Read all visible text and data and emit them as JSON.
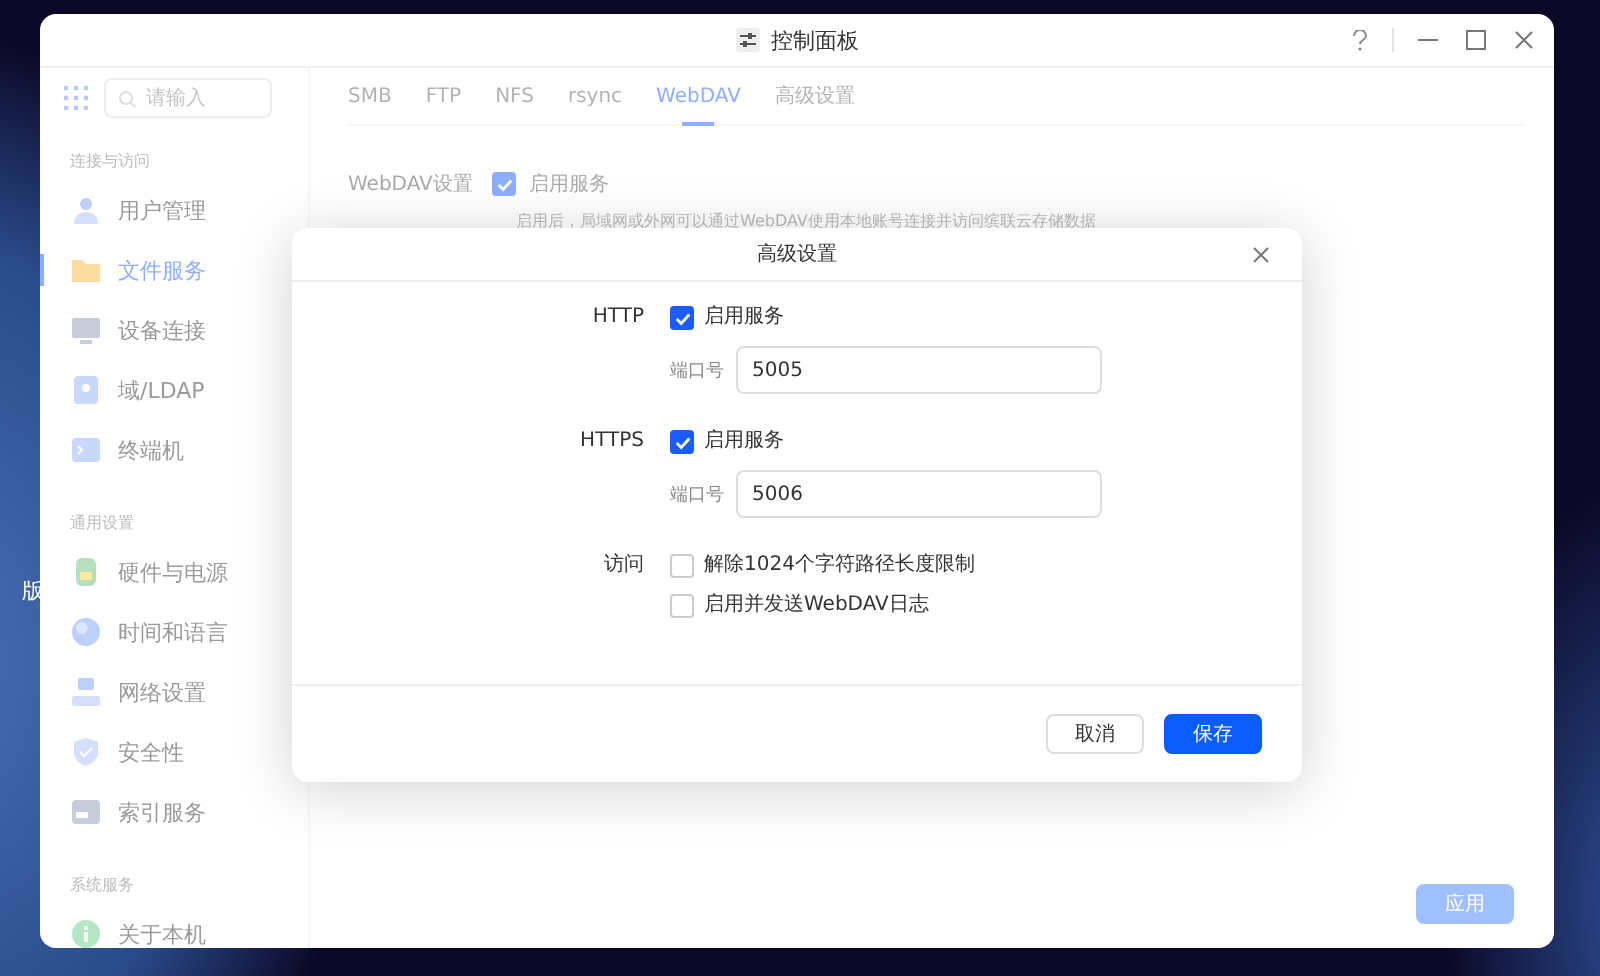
{
  "desktop": {
    "label": "版"
  },
  "window": {
    "title": "控制面板"
  },
  "sidebar": {
    "search": {
      "placeholder": "请输入"
    },
    "sections": [
      {
        "title": "连接与访问",
        "items": [
          {
            "label": "用户管理",
            "selected": false
          },
          {
            "label": "文件服务",
            "selected": true
          },
          {
            "label": "设备连接",
            "selected": false
          },
          {
            "label": "域/LDAP",
            "selected": false
          },
          {
            "label": "终端机",
            "selected": false
          }
        ]
      },
      {
        "title": "通用设置",
        "items": [
          {
            "label": "硬件与电源",
            "selected": false
          },
          {
            "label": "时间和语言",
            "selected": false
          },
          {
            "label": "网络设置",
            "selected": false
          },
          {
            "label": "安全性",
            "selected": false
          },
          {
            "label": "索引服务",
            "selected": false
          }
        ]
      },
      {
        "title": "系统服务",
        "items": [
          {
            "label": "关于本机",
            "selected": false
          }
        ]
      }
    ]
  },
  "tabs": [
    {
      "label": "SMB",
      "selected": false
    },
    {
      "label": "FTP",
      "selected": false
    },
    {
      "label": "NFS",
      "selected": false
    },
    {
      "label": "rsync",
      "selected": false
    },
    {
      "label": "WebDAV",
      "selected": true
    },
    {
      "label": "高级设置",
      "selected": false
    }
  ],
  "webdav": {
    "label": "WebDAV设置",
    "enable": {
      "label": "启用服务",
      "checked": true
    },
    "description": "启用后，局域网或外网可以通过WebDAV使用本地账号连接并访问缤联云存储数据"
  },
  "apply_button": {
    "label": "应用",
    "disabled": true
  },
  "dialog": {
    "title": "高级设置",
    "groups": [
      {
        "label": "HTTP",
        "checkboxes": [
          {
            "label": "启用服务",
            "checked": true
          }
        ],
        "port": {
          "label": "端口号",
          "value": "5005"
        }
      },
      {
        "label": "HTTPS",
        "checkboxes": [
          {
            "label": "启用服务",
            "checked": true
          }
        ],
        "port": {
          "label": "端口号",
          "value": "5006"
        }
      },
      {
        "label": "访问",
        "checkboxes": [
          {
            "label": "解除1024个字符路径长度限制",
            "checked": false
          },
          {
            "label": "启用并发送WebDAV日志",
            "checked": false
          }
        ]
      }
    ],
    "buttons": [
      {
        "label": "取消",
        "kind": "secondary"
      },
      {
        "label": "保存",
        "kind": "primary"
      }
    ]
  }
}
